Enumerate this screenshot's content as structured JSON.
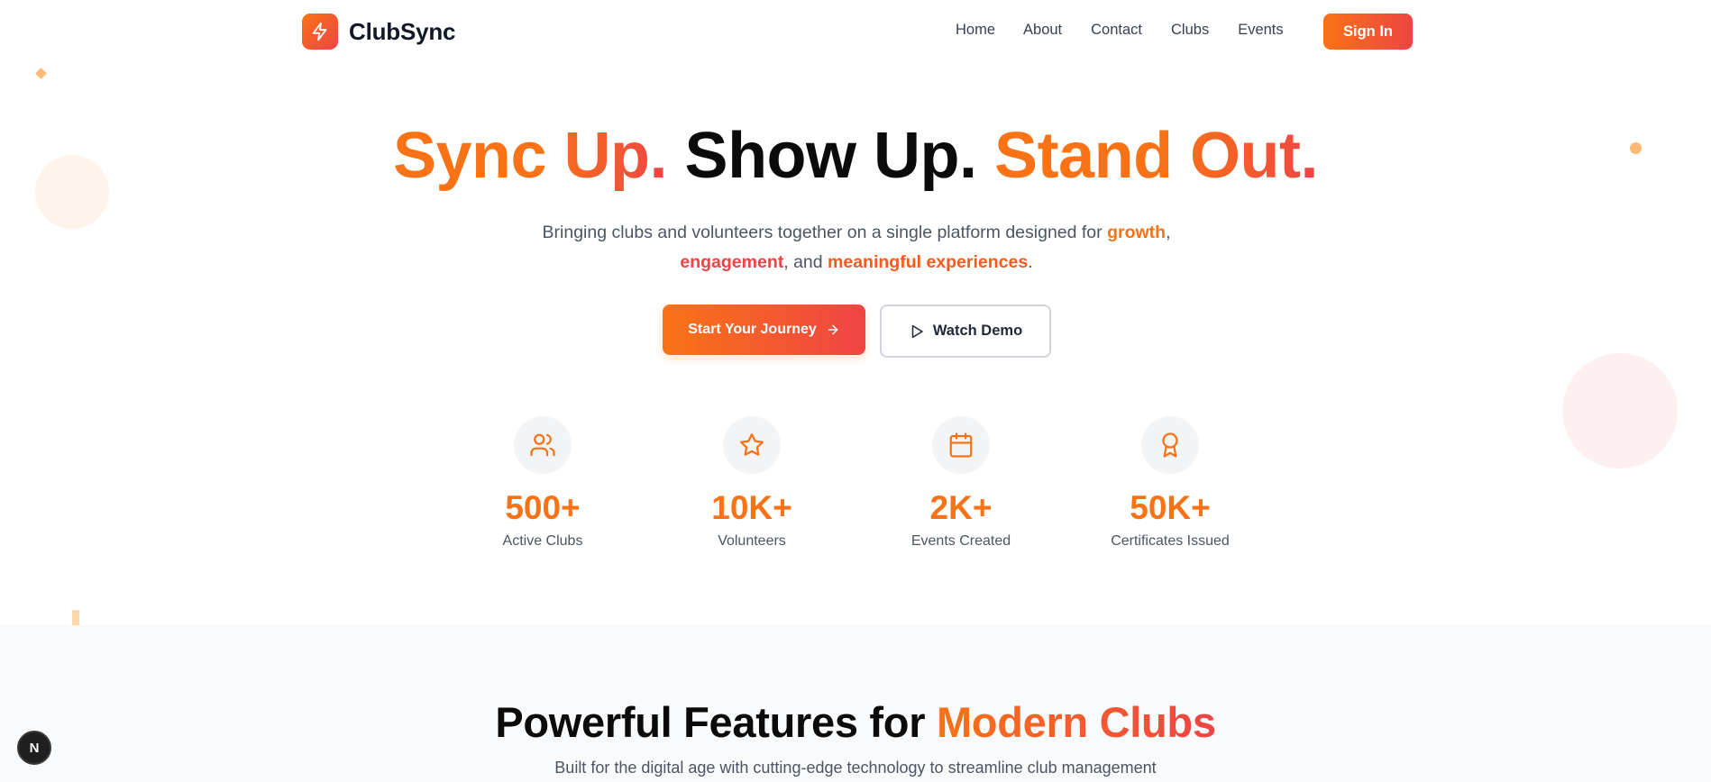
{
  "brand": {
    "name": "ClubSync",
    "logo_icon": "lightning-bolt-icon",
    "accent_start": "#f97316",
    "accent_end": "#ef4444"
  },
  "nav": {
    "links": [
      "Home",
      "About",
      "Contact",
      "Clubs",
      "Events"
    ],
    "sign_in": "Sign In"
  },
  "hero": {
    "title_part1": "Sync Up.",
    "title_part2": "Show Up.",
    "title_part3": "Stand Out.",
    "subtitle_pre": "Bringing clubs and volunteers together on a single platform designed for ",
    "hl_growth": "growth",
    "subtitle_comma": ",",
    "hl_engagement": "engagement",
    "subtitle_and": ", and ",
    "hl_experiences": "meaningful experiences",
    "subtitle_end": ".",
    "cta_primary": "Start Your Journey",
    "cta_secondary": "Watch Demo"
  },
  "stats": [
    {
      "value": "500+",
      "label": "Active Clubs",
      "icon": "users-icon"
    },
    {
      "value": "10K+",
      "label": "Volunteers",
      "icon": "star-icon"
    },
    {
      "value": "2K+",
      "label": "Events Created",
      "icon": "calendar-icon"
    },
    {
      "value": "50K+",
      "label": "Certificates Issued",
      "icon": "award-icon"
    }
  ],
  "features": {
    "title_plain": "Powerful Features for ",
    "title_accent": "Modern Clubs",
    "subtitle": "Built for the digital age with cutting-edge technology to streamline club management"
  },
  "dev_badge": "N"
}
